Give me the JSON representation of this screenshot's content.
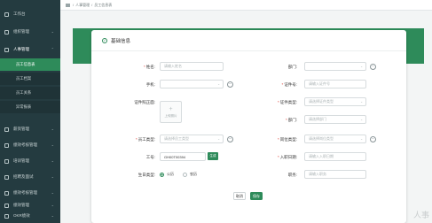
{
  "sidebar": {
    "items": [
      {
        "label": "工作台"
      },
      {
        "label": "组织管理"
      },
      {
        "label": "人事管理"
      },
      {
        "label": "薪资管理"
      },
      {
        "label": "绩效考核管理"
      },
      {
        "label": "培训管理"
      },
      {
        "label": "招聘及面试"
      },
      {
        "label": "绩效考核管理"
      },
      {
        "label": "绩效管理"
      },
      {
        "label": "OKR绩效"
      }
    ],
    "subitems": [
      {
        "label": "员工信息表"
      },
      {
        "label": "员工档案"
      },
      {
        "label": "员工关系"
      },
      {
        "label": "异常报表"
      }
    ]
  },
  "topbar": {
    "crumb1": "人事管理",
    "sep": "/",
    "crumb2": "员工信息表"
  },
  "form": {
    "section_title": "基础信息",
    "fields": {
      "name": {
        "label": "姓名:",
        "placeholder": "请输入姓名"
      },
      "dept_right": {
        "label": "部门:",
        "placeholder": ""
      },
      "phone": {
        "label": "手机:",
        "placeholder": ""
      },
      "idcard": {
        "label": "证件号:",
        "placeholder": "请输入证件号"
      },
      "photo": {
        "label": "证件照正面:",
        "upload_text": "上传照片"
      },
      "idtype": {
        "label": "证件类型:",
        "placeholder": "请选择证件类型"
      },
      "dept": {
        "label": "部门:",
        "placeholder": "请选择部门"
      },
      "emptype": {
        "label": "员工类型:",
        "placeholder": "请选择员工类型"
      },
      "postype": {
        "label": "岗位类型:",
        "placeholder": "请选择岗位类型"
      },
      "empno": {
        "label": "工号:",
        "value": "GH00T00394",
        "btn": "生成"
      },
      "hiredate": {
        "label": "入职日期:",
        "placeholder": "请输入入职日期"
      },
      "marital": {
        "label": "生日类型:",
        "opt1": "公历",
        "opt2": "农历"
      },
      "position": {
        "label": "职务:",
        "placeholder": "请输入职务"
      }
    },
    "cancel": "取消",
    "save": "保存"
  },
  "watermark": "人事"
}
